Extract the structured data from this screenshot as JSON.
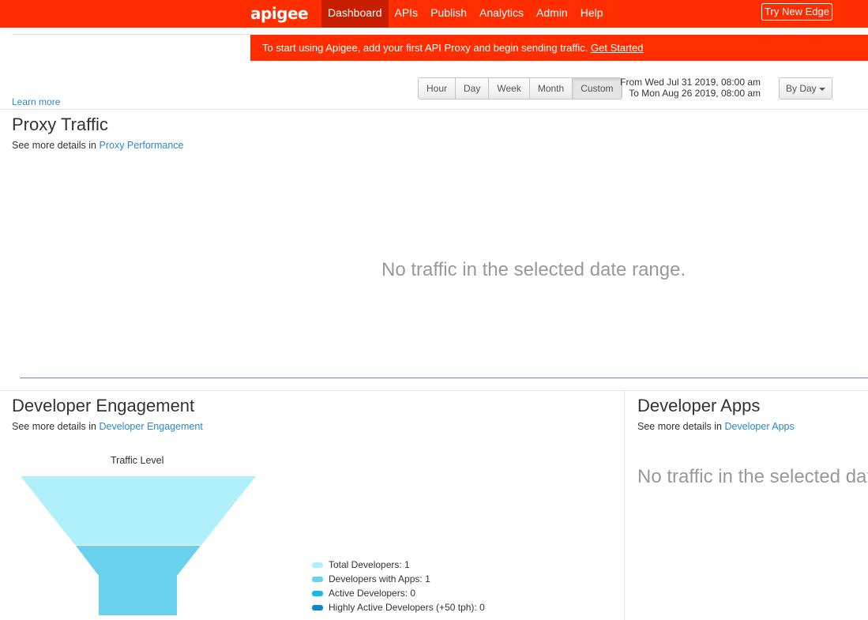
{
  "header": {
    "logo": "apigee",
    "nav": [
      {
        "label": "Dashboard"
      },
      {
        "label": "APIs"
      },
      {
        "label": "Publish"
      },
      {
        "label": "Analytics"
      },
      {
        "label": "Admin"
      },
      {
        "label": "Help"
      }
    ],
    "try_button": "Try New Edge"
  },
  "banner": {
    "text": "To start using Apigee, add your first API Proxy and begin sending traffic.",
    "link": "Get Started"
  },
  "learn_more": "Learn more",
  "time_range": {
    "buttons": [
      "Hour",
      "Day",
      "Week",
      "Month",
      "Custom"
    ],
    "selected": "Custom",
    "from": "From  Wed Jul 31 2019, 08:00 am",
    "to": "To Mon Aug 26 2019, 08:00 am",
    "interval": "By Day"
  },
  "proxy_traffic": {
    "title": "Proxy Traffic",
    "details_prefix": "See more details in",
    "details_link": "Proxy Performance",
    "empty": "No traffic in the selected date range."
  },
  "developer_engagement": {
    "title": "Developer Engagement",
    "details_prefix": "See more details in",
    "details_link": "Developer Engagement",
    "funnel_title": "Traffic Level",
    "legend": [
      {
        "label": "Total Developers: 1",
        "color": "#b0f0fa"
      },
      {
        "label": "Developers with Apps: 1",
        "color": "#6ad2ec"
      },
      {
        "label": "Active Developers: 0",
        "color": "#19b9e6"
      },
      {
        "label": "Highly Active Developers (+50 tph): 0",
        "color": "#0a88cc"
      }
    ]
  },
  "developer_apps": {
    "title": "Developer Apps",
    "details_prefix": "See more details in",
    "details_link": "Developer Apps",
    "empty": "No traffic in the selected date range."
  }
}
